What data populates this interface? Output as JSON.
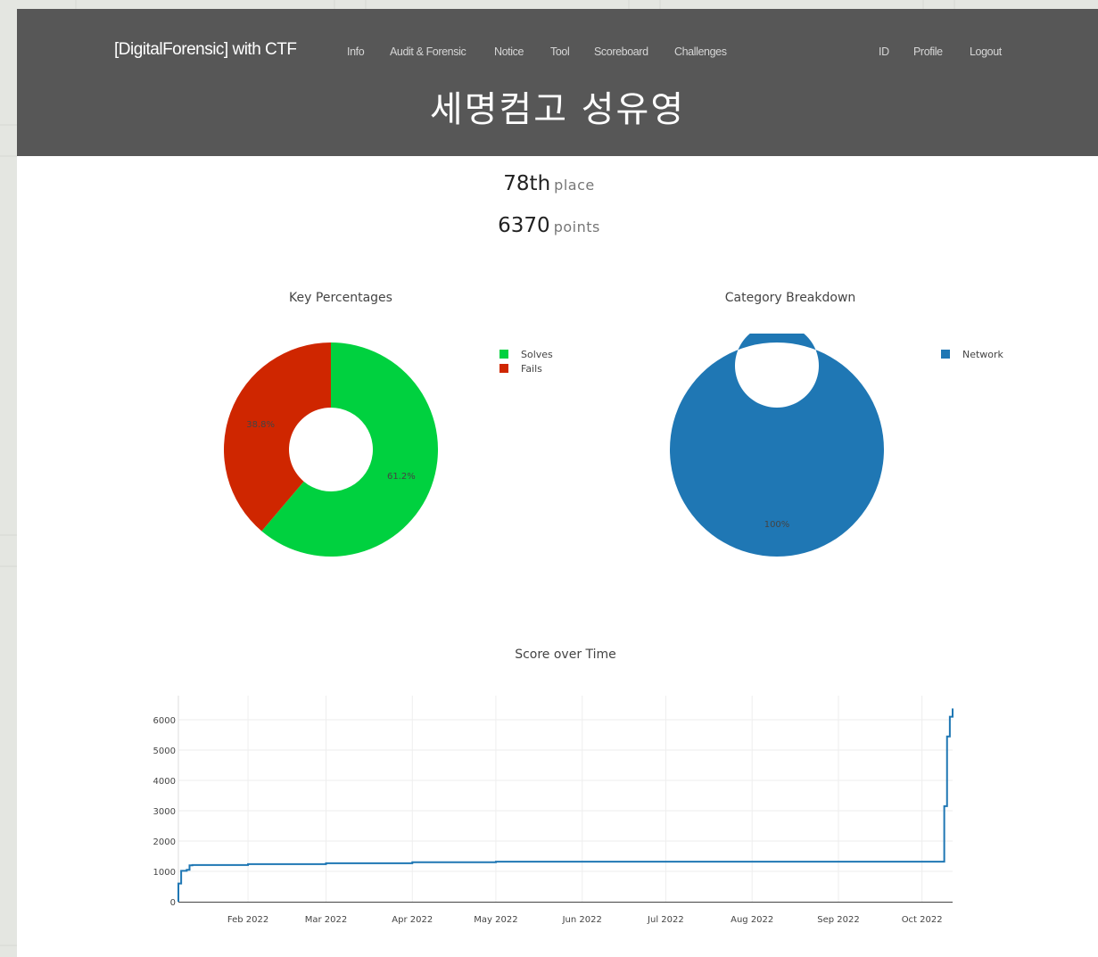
{
  "navbar": {
    "brand": "[DigitalForensic] with CTF",
    "links": [
      {
        "label": "Info"
      },
      {
        "label": "Audit & Forensic"
      },
      {
        "label": "Notice"
      },
      {
        "label": "Tool"
      },
      {
        "label": "Scoreboard"
      },
      {
        "label": "Challenges"
      }
    ],
    "right_links": [
      {
        "label": "ID"
      },
      {
        "label": "Profile"
      },
      {
        "label": "Logout"
      }
    ]
  },
  "team": {
    "name": "세명컴고 성유영",
    "place": "78th",
    "place_label": "place",
    "score": "6370",
    "score_label": "points"
  },
  "colors": {
    "navbar_bg": "#575757",
    "solves": "#00d13f",
    "fails": "#cf2600",
    "network": "#1f77b4",
    "score_line": "#1f77b4"
  },
  "chart_data": [
    {
      "type": "pie",
      "title": "Key Percentages",
      "hole": true,
      "labels": [
        "Solves",
        "Fails"
      ],
      "values": [
        61.2,
        38.8
      ],
      "value_labels": [
        "61.2%",
        "38.8%"
      ],
      "colors": [
        "#00d13f",
        "#cf2600"
      ],
      "legend": "top-right"
    },
    {
      "type": "pie",
      "title": "Category Breakdown",
      "hole": true,
      "labels": [
        "Network"
      ],
      "values": [
        100
      ],
      "value_labels": [
        "100%"
      ],
      "colors": [
        "#1f77b4"
      ],
      "legend": "top-right"
    },
    {
      "type": "line",
      "title": "Score over Time",
      "xlabel": "",
      "ylabel": "",
      "x_ticks": [
        "Feb 2022",
        "Mar 2022",
        "Apr 2022",
        "May 2022",
        "Jun 2022",
        "Jul 2022",
        "Aug 2022",
        "Sep 2022",
        "Oct 2022"
      ],
      "y_ticks": [
        "0",
        "1000",
        "2000",
        "3000",
        "4000",
        "5000",
        "6000"
      ],
      "xlim": [
        "2022-01-07",
        "2022-10-12"
      ],
      "ylim": [
        0,
        6000
      ],
      "grid": true,
      "step": true,
      "series": [
        {
          "x": [
            "2022-01-07",
            "2022-01-07",
            "2022-01-08",
            "2022-01-10",
            "2022-01-11",
            "2022-01-12",
            "2022-02-01",
            "2022-03-01",
            "2022-04-01",
            "2022-05-01",
            "2022-10-09",
            "2022-10-09",
            "2022-10-10",
            "2022-10-11",
            "2022-10-11",
            "2022-10-12"
          ],
          "y": [
            0,
            600,
            1020,
            1050,
            1200,
            1210,
            1240,
            1270,
            1300,
            1320,
            1350,
            3150,
            5450,
            5600,
            6100,
            6370
          ]
        }
      ]
    }
  ]
}
